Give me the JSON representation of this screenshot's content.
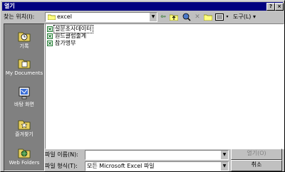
{
  "window": {
    "title": "열기",
    "help_label": "?",
    "close_label": "×"
  },
  "toolbar": {
    "look_in_label": "찾는 위치(I):",
    "look_in_value": "excel",
    "tools_label": "도구(L) ▾"
  },
  "places": [
    {
      "label": "기록",
      "icon": "history-icon"
    },
    {
      "label": "My Documents",
      "icon": "my-documents-icon"
    },
    {
      "label": "바탕 화면",
      "icon": "desktop-icon"
    },
    {
      "label": "즐겨찾기",
      "icon": "favorites-icon"
    },
    {
      "label": "Web Folders",
      "icon": "web-folders-icon"
    }
  ],
  "files": [
    {
      "name": "설문조사데이터"
    },
    {
      "name": "원드클럽출계"
    },
    {
      "name": "참가명부"
    }
  ],
  "footer": {
    "filename_label": "파일 이름(N):",
    "filename_value": "",
    "filetype_label": "파일 형식(T):",
    "filetype_value": "모든 Microsoft Excel 파일",
    "open_label": "열기(O)",
    "cancel_label": "취소"
  },
  "colors": {
    "titlebar": "#000080",
    "face": "#c0c0c0",
    "places_bg": "#808080",
    "excel_green": "#1d7a2f"
  }
}
